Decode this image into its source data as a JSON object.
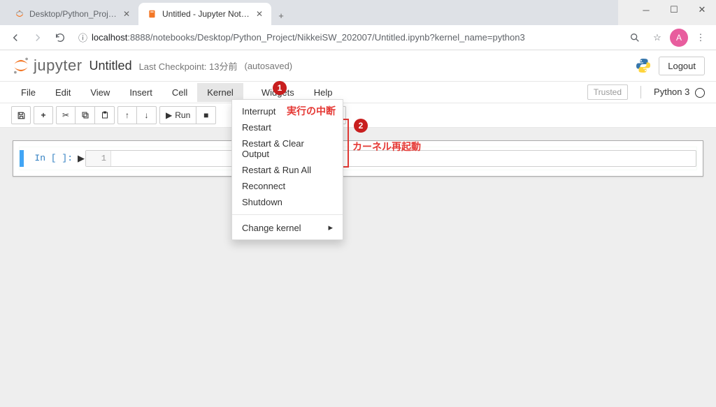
{
  "browser": {
    "tabs": [
      {
        "title": "Desktop/Python_Project/NikkeiS",
        "active": false
      },
      {
        "title": "Untitled - Jupyter Notebook",
        "active": true
      }
    ],
    "url_host": "localhost",
    "url_port": ":8888",
    "url_path": "/notebooks/Desktop/Python_Project/NikkeiSW_202007/Untitled.ipynb?kernel_name=python3",
    "avatar_letter": "A"
  },
  "jupyter": {
    "logo_text": "jupyter",
    "title": "Untitled",
    "checkpoint": "Last Checkpoint: 13分前",
    "autosave": "(autosaved)",
    "logout": "Logout"
  },
  "menubar": {
    "items": [
      "File",
      "Edit",
      "View",
      "Insert",
      "Cell",
      "Kernel",
      "Widgets",
      "Help"
    ],
    "trusted": "Trusted",
    "kernel": "Python 3"
  },
  "toolbar": {
    "run_label": "Run"
  },
  "dropdown": {
    "items": [
      "Interrupt",
      "Restart",
      "Restart & Clear Output",
      "Restart & Run All",
      "Reconnect",
      "Shutdown"
    ],
    "change_kernel": "Change kernel"
  },
  "cell": {
    "prompt": "In [ ]:",
    "line_num": "1"
  },
  "annotations": {
    "label1": "実行の中断",
    "label2": "カーネル再起動",
    "badge1": "1",
    "badge2": "2"
  }
}
